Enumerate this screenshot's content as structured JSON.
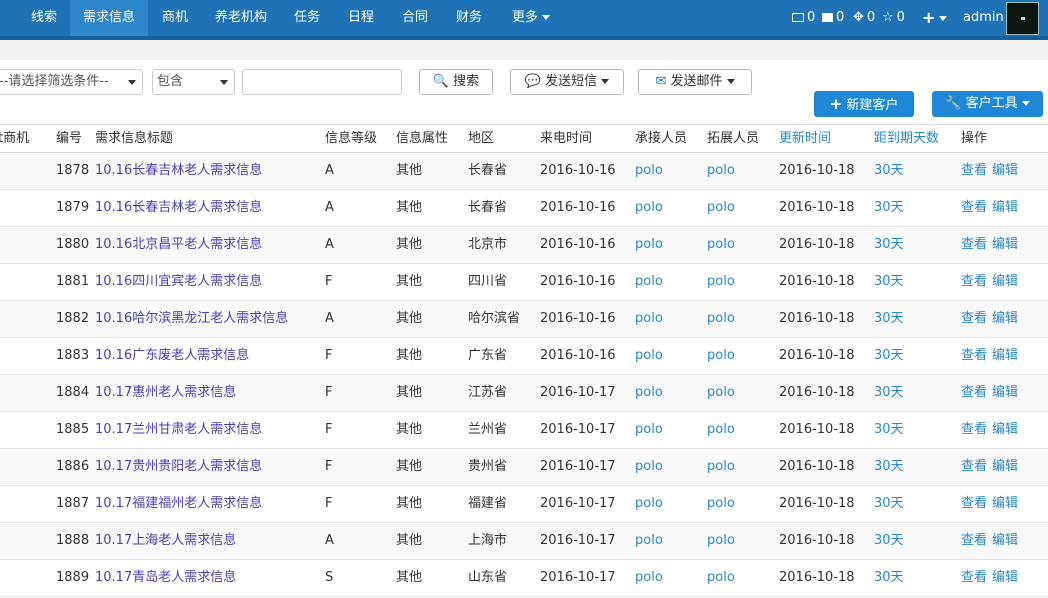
{
  "nav": {
    "items": [
      {
        "label": "线索",
        "key": "leads"
      },
      {
        "label": "需求信息",
        "key": "demand"
      },
      {
        "label": "商机",
        "key": "opportunity"
      },
      {
        "label": "养老机构",
        "key": "institution"
      },
      {
        "label": "任务",
        "key": "tasks"
      },
      {
        "label": "日程",
        "key": "schedule"
      },
      {
        "label": "合同",
        "key": "contract"
      },
      {
        "label": "财务",
        "key": "finance"
      },
      {
        "label": "更多",
        "key": "more"
      }
    ],
    "active": "需求信息",
    "notifications": {
      "mail": "0",
      "messages": "0",
      "tasks": "0",
      "stars": "0"
    },
    "user": "admin"
  },
  "filters": {
    "condition_placeholder": "--请选择筛选条件--",
    "operator": "包含",
    "search_value": "",
    "search_label": "搜索",
    "sms_label": "发送短信",
    "email_label": "发送邮件",
    "new_customer_label": "新建客户",
    "customer_tools_label": "客户工具"
  },
  "table": {
    "headers": {
      "opportunity": "t商机",
      "id": "编号",
      "title": "需求信息标题",
      "level": "信息等级",
      "attr": "信息属性",
      "region": "地区",
      "call_time": "来电时间",
      "handler": "承接人员",
      "expander": "拓展人员",
      "updated": "更新时间",
      "days_left": "距到期天数",
      "action": "操作"
    },
    "action_view": "查看",
    "action_edit": "编辑",
    "rows": [
      {
        "id": "1878",
        "title": "10.16长春吉林老人需求信息",
        "level": "A",
        "attr": "其他",
        "region": "长春省",
        "call_time": "2016-10-16",
        "handler": "polo",
        "expander": "polo",
        "updated": "2016-10-18",
        "days_left": "30天"
      },
      {
        "id": "1879",
        "title": "10.16长春吉林老人需求信息",
        "level": "A",
        "attr": "其他",
        "region": "长春省",
        "call_time": "2016-10-16",
        "handler": "polo",
        "expander": "polo",
        "updated": "2016-10-18",
        "days_left": "30天"
      },
      {
        "id": "1880",
        "title": "10.16北京昌平老人需求信息",
        "level": "A",
        "attr": "其他",
        "region": "北京市",
        "call_time": "2016-10-16",
        "handler": "polo",
        "expander": "polo",
        "updated": "2016-10-18",
        "days_left": "30天"
      },
      {
        "id": "1881",
        "title": "10.16四川宜宾老人需求信息",
        "level": "F",
        "attr": "其他",
        "region": "四川省",
        "call_time": "2016-10-16",
        "handler": "polo",
        "expander": "polo",
        "updated": "2016-10-18",
        "days_left": "30天"
      },
      {
        "id": "1882",
        "title": "10.16哈尔滨黑龙江老人需求信息",
        "level": "A",
        "attr": "其他",
        "region": "哈尔滨省",
        "call_time": "2016-10-16",
        "handler": "polo",
        "expander": "polo",
        "updated": "2016-10-18",
        "days_left": "30天"
      },
      {
        "id": "1883",
        "title": "10.16广东废老人需求信息",
        "level": "F",
        "attr": "其他",
        "region": "广东省",
        "call_time": "2016-10-16",
        "handler": "polo",
        "expander": "polo",
        "updated": "2016-10-18",
        "days_left": "30天"
      },
      {
        "id": "1884",
        "title": "10.17惠州老人需求信息",
        "level": "F",
        "attr": "其他",
        "region": "江苏省",
        "call_time": "2016-10-17",
        "handler": "polo",
        "expander": "polo",
        "updated": "2016-10-18",
        "days_left": "30天"
      },
      {
        "id": "1885",
        "title": "10.17兰州甘肃老人需求信息",
        "level": "F",
        "attr": "其他",
        "region": "兰州省",
        "call_time": "2016-10-17",
        "handler": "polo",
        "expander": "polo",
        "updated": "2016-10-18",
        "days_left": "30天"
      },
      {
        "id": "1886",
        "title": "10.17贵州贵阳老人需求信息",
        "level": "F",
        "attr": "其他",
        "region": "贵州省",
        "call_time": "2016-10-17",
        "handler": "polo",
        "expander": "polo",
        "updated": "2016-10-18",
        "days_left": "30天"
      },
      {
        "id": "1887",
        "title": "10.17福建福州老人需求信息",
        "level": "F",
        "attr": "其他",
        "region": "福建省",
        "call_time": "2016-10-17",
        "handler": "polo",
        "expander": "polo",
        "updated": "2016-10-18",
        "days_left": "30天"
      },
      {
        "id": "1888",
        "title": "10.17上海老人需求信息",
        "level": "A",
        "attr": "其他",
        "region": "上海市",
        "call_time": "2016-10-17",
        "handler": "polo",
        "expander": "polo",
        "updated": "2016-10-18",
        "days_left": "30天"
      },
      {
        "id": "1889",
        "title": "10.17青岛老人需求信息",
        "level": "S",
        "attr": "其他",
        "region": "山东省",
        "call_time": "2016-10-17",
        "handler": "polo",
        "expander": "polo",
        "updated": "2016-10-18",
        "days_left": "30天"
      }
    ]
  },
  "colors": {
    "nav": "#1e72b5",
    "nav_active": "#2d86c9",
    "primary_button": "#1e88d6",
    "link": "#2a88c8",
    "title_link": "#4b3fb5"
  }
}
